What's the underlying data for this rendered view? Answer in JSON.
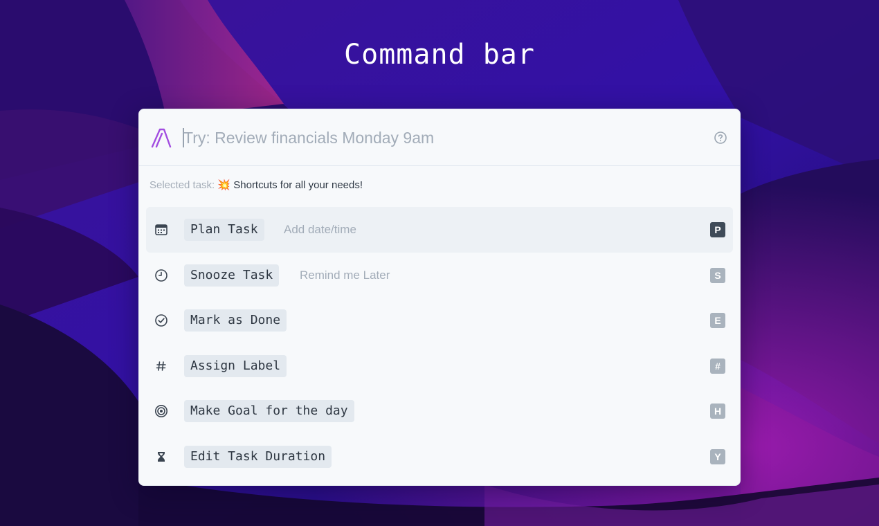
{
  "page": {
    "title": "Command bar"
  },
  "command_bar": {
    "search": {
      "value": "",
      "placeholder": "Try: Review financials Monday 9am"
    },
    "selected_task": {
      "prefix": "Selected task:",
      "emoji": "💥",
      "name": "Shortcuts for all your needs!"
    },
    "items": [
      {
        "label": "Plan Task",
        "hint": "Add date/time",
        "key": "P",
        "icon": "calendar-icon",
        "active": true
      },
      {
        "label": "Snooze Task",
        "hint": "Remind me Later",
        "key": "S",
        "icon": "clock-icon",
        "active": false
      },
      {
        "label": "Mark as Done",
        "hint": "",
        "key": "E",
        "icon": "check-circle-icon",
        "active": false
      },
      {
        "label": "Assign Label",
        "hint": "",
        "key": "#",
        "icon": "hash-icon",
        "active": false
      },
      {
        "label": "Make Goal for the day",
        "hint": "",
        "key": "H",
        "icon": "target-icon",
        "active": false
      },
      {
        "label": "Edit Task Duration",
        "hint": "",
        "key": "Y",
        "icon": "hourglass-icon",
        "active": false
      }
    ]
  },
  "colors": {
    "accent": "#a24de0",
    "panel_background": "#f7f9fb",
    "active_key": "#3f4b58",
    "inactive_key": "#a9b3bd"
  }
}
